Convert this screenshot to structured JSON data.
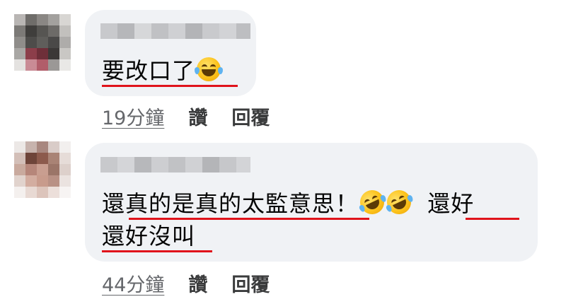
{
  "comments": [
    {
      "author": "",
      "text": "要改口了",
      "emojis": [
        "face-with-tears-of-joy-icon"
      ],
      "time": "19分鐘",
      "like_label": "讚",
      "reply_label": "回覆"
    },
    {
      "author": "",
      "text_line1_a": "還真的是真的太監意思！",
      "emojis": [
        "rolling-on-the-floor-laughing-icon",
        "rolling-on-the-floor-laughing-icon"
      ],
      "text_line1_b": "還好",
      "text_line2": "還好沒叫",
      "time": "44分鐘",
      "like_label": "讚",
      "reply_label": "回覆"
    }
  ],
  "colors": {
    "bubble": "#f0f2f5",
    "underline": "#e0131b",
    "meta_text": "#65676b"
  }
}
